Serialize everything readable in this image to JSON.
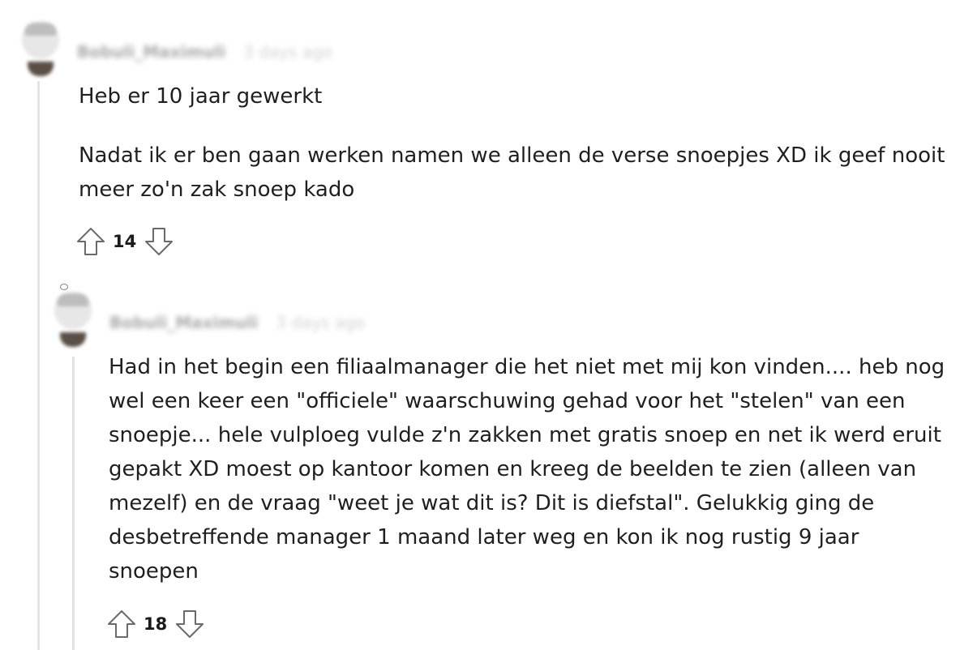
{
  "comments": [
    {
      "username": "Bobuli_Maximuli",
      "time": "3 days ago",
      "paragraphs": [
        "Heb er 10 jaar gewerkt",
        "Nadat ik er ben gaan werken namen we alleen de verse snoepjes XD ik geef nooit meer zo'n zak snoep kado"
      ],
      "votes": "14"
    },
    {
      "username": "Bobuli_Maximuli",
      "time": "3 days ago",
      "paragraphs": [
        "Had in het begin een filiaalmanager die het niet met mij kon vinden.... heb nog wel een keer een \"officiele\" waarschuwing gehad voor het \"stelen\" van een snoepje... hele vulploeg vulde z'n zakken met gratis snoep en net ik werd eruit gepakt XD moest op kantoor komen en kreeg de beelden te zien (alleen van mezelf) en de vraag \"weet je wat dit is? Dit is diefstal\". Gelukkig ging de desbetreffende manager 1 maand later weg en kon ik nog rustig 9 jaar snoepen"
      ],
      "votes": "18"
    }
  ],
  "icons": {
    "upvote": "arrow-up-outline",
    "downvote": "arrow-down-outline"
  }
}
